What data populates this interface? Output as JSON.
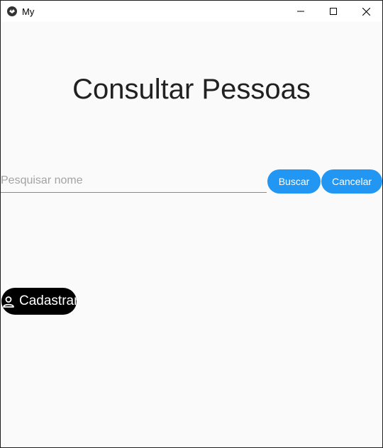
{
  "window": {
    "title": "My",
    "app_icon": "kivy-logo-icon",
    "controls": [
      "minimize-icon",
      "maximize-icon",
      "close-icon"
    ]
  },
  "main": {
    "heading": "Consultar Pessoas",
    "search": {
      "value": "",
      "placeholder": "Pesquisar nome"
    },
    "buscar_label": "Buscar",
    "cancelar_label": "Cancelar",
    "fab": {
      "icon": "account-outline-icon",
      "label": "Cadastrar"
    }
  },
  "colors": {
    "accent": "#2196f3",
    "background": "#fafafa",
    "text": "#212121",
    "fab_background": "#000000"
  }
}
